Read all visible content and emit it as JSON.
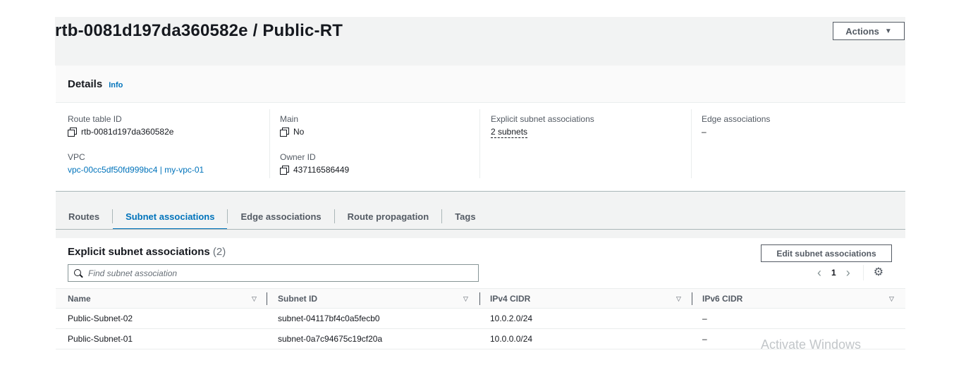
{
  "page": {
    "title": "rtb-0081d197da360582e / Public-RT",
    "actions_label": "Actions"
  },
  "details": {
    "heading": "Details",
    "info_label": "Info",
    "route_table_id": {
      "label": "Route table ID",
      "value": "rtb-0081d197da360582e"
    },
    "vpc": {
      "label": "VPC",
      "value": "vpc-00cc5df50fd999bc4 | my-vpc-01"
    },
    "main": {
      "label": "Main",
      "value": "No"
    },
    "owner_id": {
      "label": "Owner ID",
      "value": "437116586449"
    },
    "explicit_subnet_associations": {
      "label": "Explicit subnet associations",
      "value": "2 subnets"
    },
    "edge_associations": {
      "label": "Edge associations",
      "value": "–"
    }
  },
  "tabs": [
    {
      "label": "Routes",
      "active": false
    },
    {
      "label": "Subnet associations",
      "active": true
    },
    {
      "label": "Edge associations",
      "active": false
    },
    {
      "label": "Route propagation",
      "active": false
    },
    {
      "label": "Tags",
      "active": false
    }
  ],
  "associations": {
    "title": "Explicit subnet associations",
    "count": "(2)",
    "edit_label": "Edit subnet associations",
    "search_placeholder": "Find subnet association",
    "page_number": "1",
    "columns": [
      "Name",
      "Subnet ID",
      "IPv4 CIDR",
      "IPv6 CIDR"
    ],
    "rows": [
      {
        "name": "Public-Subnet-02",
        "subnet_id": "subnet-04117bf4c0a5fecb0",
        "ipv4": "10.0.2.0/24",
        "ipv6": "–"
      },
      {
        "name": "Public-Subnet-01",
        "subnet_id": "subnet-0a7c94675c19cf20a",
        "ipv4": "10.0.0.0/24",
        "ipv6": "–"
      }
    ]
  },
  "watermark": "Activate Windows",
  "colors": {
    "link": "#0073bb",
    "text": "#16191f",
    "muted": "#545b64",
    "band": "#f2f3f3"
  }
}
